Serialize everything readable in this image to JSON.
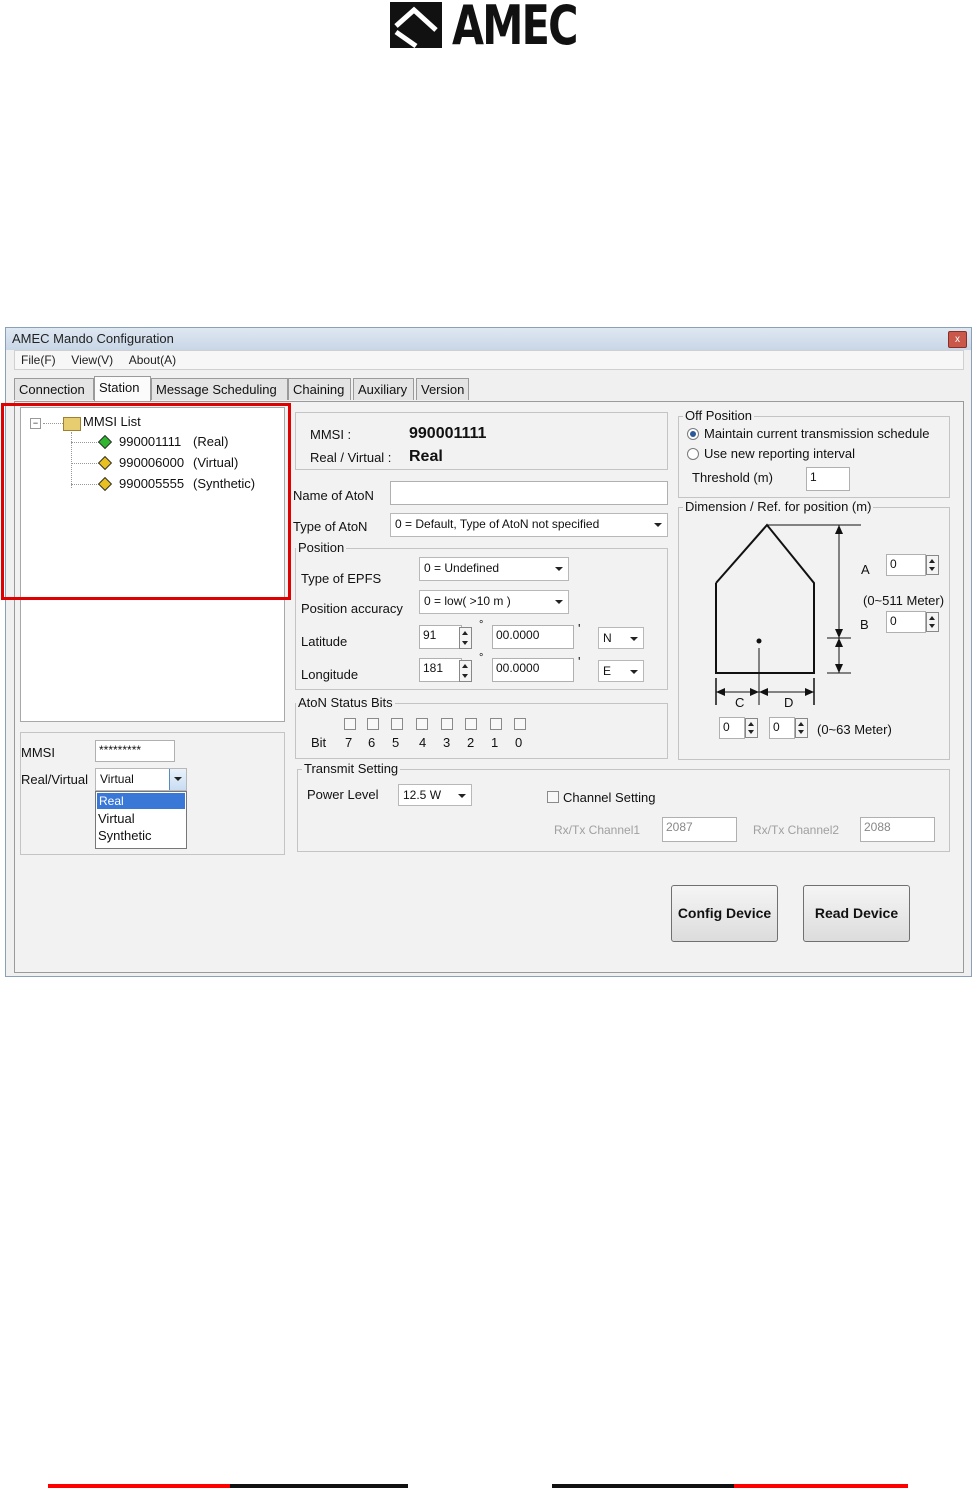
{
  "logo": {
    "text": "AMEC"
  },
  "window": {
    "title": "AMEC Mando Configuration",
    "close_glyph": "x"
  },
  "menu": [
    "File(F)",
    "View(V)",
    "About(A)"
  ],
  "tabs": [
    "Connection",
    "Station",
    "Message Scheduling",
    "Chaining",
    "Auxiliary",
    "Version"
  ],
  "tree": {
    "root": "MMSI List",
    "items": [
      {
        "mmsi": "990001111",
        "type": "(Real)",
        "color": "#2fb82f"
      },
      {
        "mmsi": "990006000",
        "type": "(Virtual)",
        "color": "#e8c020"
      },
      {
        "mmsi": "990005555",
        "type": "(Synthetic)",
        "color": "#e8c020"
      }
    ]
  },
  "left_form": {
    "mmsi_label": "MMSI",
    "mmsi_value": "*********",
    "rv_label": "Real/Virtual",
    "rv_value": "Virtual",
    "options": [
      "Real",
      "Virtual",
      "Synthetic"
    ]
  },
  "info": {
    "mmsi_label": "MMSI :",
    "mmsi_value": "990001111",
    "rv_label": "Real / Virtual :",
    "rv_value": "Real"
  },
  "aton": {
    "name_label": "Name of AtoN",
    "name_value": "",
    "type_label": "Type of AtoN",
    "type_value": "0 = Default, Type of AtoN not specified"
  },
  "position": {
    "title": "Position",
    "epfs_label": "Type of EPFS",
    "epfs_value": "0 = Undefined",
    "accuracy_label": "Position accuracy",
    "accuracy_value": "0 = low( >10 m )",
    "lat_label": "Latitude",
    "lat_deg": "91",
    "lat_min": "00.0000",
    "lat_dir": "N",
    "lon_label": "Longitude",
    "lon_deg": "181",
    "lon_min": "00.0000",
    "lon_dir": "E",
    "deg_sym": "°",
    "min_sym": "'"
  },
  "status_bits": {
    "title": "AtoN Status Bits",
    "bit_label": "Bit",
    "bits": [
      "7",
      "6",
      "5",
      "4",
      "3",
      "2",
      "1",
      "0"
    ]
  },
  "off_position": {
    "title": "Off Position",
    "opt1": "Maintain current transmission schedule",
    "opt2": "Use new reporting interval",
    "threshold_label": "Threshold (m)",
    "threshold_value": "1"
  },
  "dimension": {
    "title": "Dimension / Ref. for position (m)",
    "a_label": "A",
    "a_value": "0",
    "range1": "(0~511 Meter)",
    "b_label": "B",
    "b_value": "0",
    "c_label": "C",
    "d_label": "D",
    "c_value": "0",
    "d_value": "0",
    "range2": "(0~63 Meter)"
  },
  "transmit": {
    "title": "Transmit Setting",
    "power_label": "Power Level",
    "power_value": "12.5 W",
    "channel_label": "Channel Setting",
    "rx1_label": "Rx/Tx Channel1",
    "rx1_value": "2087",
    "rx2_label": "Rx/Tx Channel2",
    "rx2_value": "2088"
  },
  "buttons": {
    "config": "Config Device",
    "read": "Read Device"
  },
  "colors": {
    "highlight": "#e00000",
    "accent_blue": "#3a78d8",
    "footer_red": "#ff0000"
  }
}
